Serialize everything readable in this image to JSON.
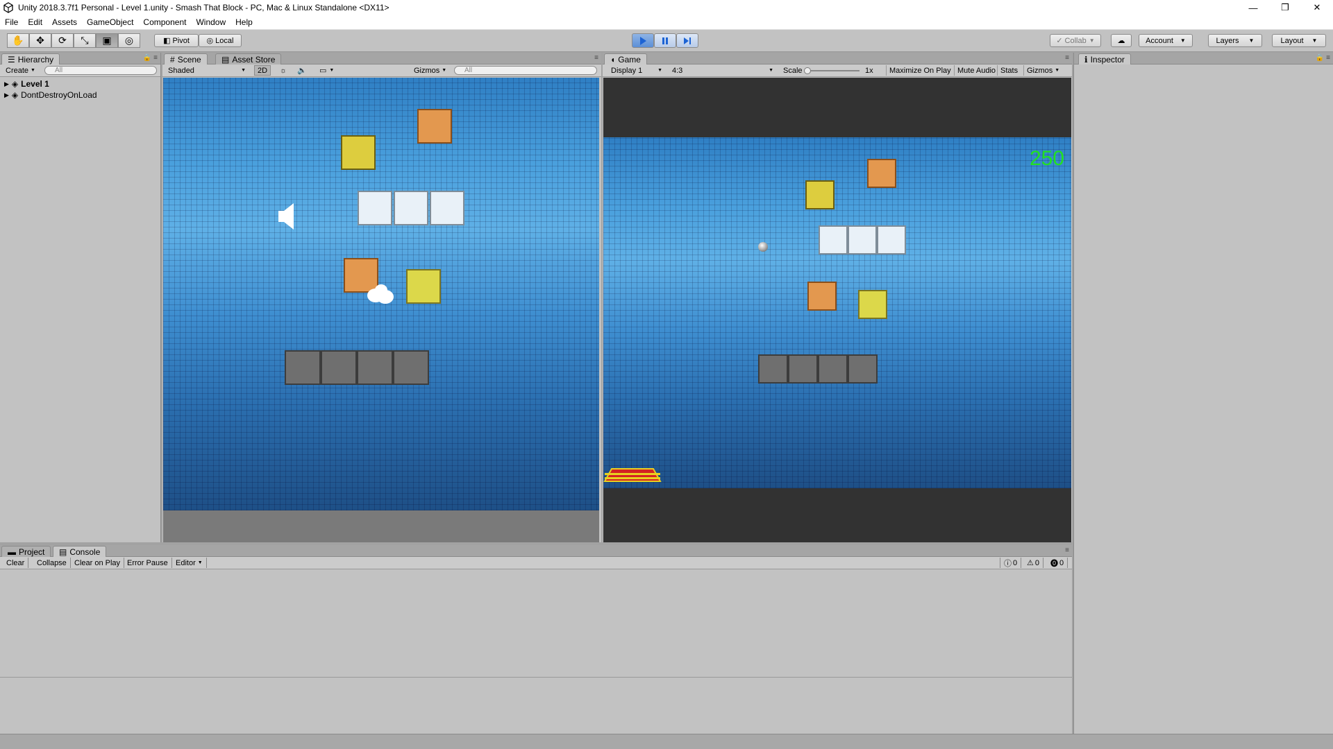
{
  "window": {
    "title": "Unity 2018.3.7f1 Personal - Level 1.unity - Smash That Block - PC, Mac & Linux Standalone <DX11>",
    "minimize": "—",
    "restore": "❐",
    "close": "✕"
  },
  "menu": [
    "File",
    "Edit",
    "Assets",
    "GameObject",
    "Component",
    "Window",
    "Help"
  ],
  "toolbar": {
    "pivot": "Pivot",
    "local": "Local",
    "collab": "Collab",
    "account": "Account",
    "layers": "Layers",
    "layout": "Layout"
  },
  "hierarchy": {
    "tab": "Hierarchy",
    "create": "Create",
    "search_placeholder": "All",
    "items": [
      "Level 1",
      "DontDestroyOnLoad"
    ]
  },
  "scene": {
    "tabs": [
      "Scene",
      "Asset Store"
    ],
    "shading": "Shaded",
    "mode_2d": "2D",
    "gizmos": "Gizmos",
    "search_placeholder": "All"
  },
  "game": {
    "tab": "Game",
    "display": "Display 1",
    "aspect": "4:3",
    "scale_label": "Scale",
    "scale_value": "1x",
    "maximize": "Maximize On Play",
    "mute": "Mute Audio",
    "stats": "Stats",
    "gizmos": "Gizmos",
    "score": "250"
  },
  "inspector": {
    "tab": "Inspector"
  },
  "bottom": {
    "tabs": [
      "Project",
      "Console"
    ],
    "buttons": [
      "Clear",
      "Collapse",
      "Clear on Play",
      "Error Pause",
      "Editor"
    ],
    "counts": {
      "info": "0",
      "warning": "0",
      "error": "0"
    }
  },
  "colors": {
    "editor_bg": "#c2c2c2",
    "sky_blue": "#3d8fd0",
    "score_green": "#22e022"
  }
}
